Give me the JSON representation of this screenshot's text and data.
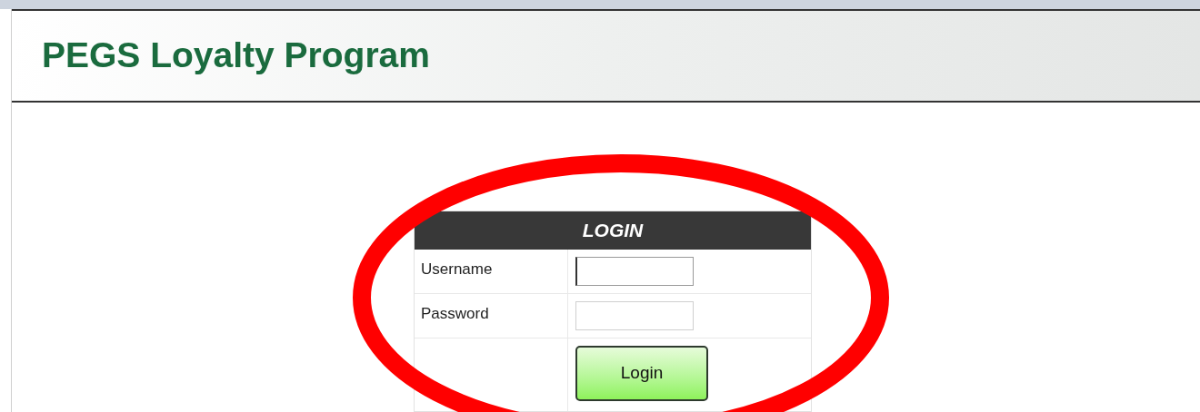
{
  "header": {
    "title": "PEGS Loyalty Program"
  },
  "login": {
    "title": "LOGIN",
    "fields": [
      {
        "label": "Username",
        "focused": true
      },
      {
        "label": "Password",
        "focused": false
      }
    ],
    "button": "Login"
  },
  "annotation": {
    "kind": "ellipse",
    "color": "#ff0000"
  }
}
